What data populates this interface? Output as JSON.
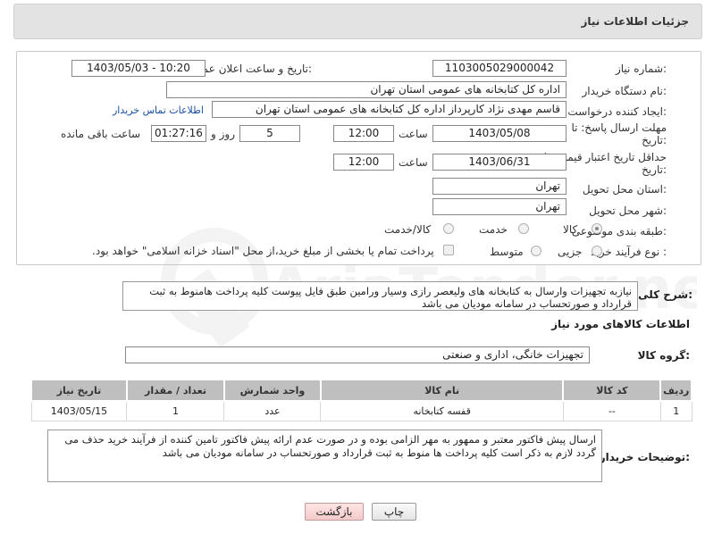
{
  "header": {
    "title": "جزئیات اطلاعات نیاز"
  },
  "fields": {
    "need_number_label": "شماره نیاز:",
    "need_number": "1103005029000042",
    "announce_label": "تاریخ و ساعت اعلان عمومی:",
    "announce_value": "1403/05/03 - 10:20",
    "buyer_org_label": "نام دستگاه خریدار:",
    "buyer_org": "اداره کل کتابخانه های عمومی استان تهران",
    "requester_label": "ایجاد کننده درخواست:",
    "requester": "قاسم مهدی نژاد کارپرداز اداره کل کتابخانه های عمومی استان تهران",
    "contact_link": "اطلاعات تماس خریدار",
    "reply_deadline_label_1": "مهلت ارسال پاسخ: تا",
    "reply_deadline_label_2": "تاریخ:",
    "reply_date": "1403/05/08",
    "time_label": "ساعت",
    "reply_time": "12:00",
    "days": "5",
    "days_label": "روز و",
    "remaining_time": "01:27:16",
    "remaining_label": "ساعت باقی مانده",
    "price_validity_label_1": "حداقل تاریخ اعتبار قیمت: تا",
    "price_validity_label_2": "تاریخ:",
    "validity_date": "1403/06/31",
    "validity_time": "12:00",
    "province_label": "استان محل تحویل:",
    "province": "تهران",
    "city_label": "شهر محل تحویل:",
    "city": "تهران",
    "category_label": "طبقه بندی موضوعی:",
    "category_options": [
      "کالا",
      "خدمت",
      "کالا/خدمت"
    ],
    "process_label": "نوع فرآیند خرید :",
    "process_options": [
      "جزیی",
      "متوسط"
    ],
    "payment_note": "پرداخت تمام یا بخشی از مبلغ خرید،از محل \"اسناد خزانه اسلامی\" خواهد بود."
  },
  "description": {
    "label": "شرح کلی نیاز:",
    "text": "نیازبه تجهیزات وارسال به کتابخانه های ولیعصر رازی وسیار ورامین طبق فایل پیوست کلیه پرداخت هامنوط به ثبت قرارداد و صورتحساب در سامانه مودیان می باشد"
  },
  "goods_info_title": "اطلاعات کالاهای مورد نیاز",
  "goods_group": {
    "label": "گروه کالا:",
    "value": "تجهیزات خانگی، اداری و صنعتی"
  },
  "table": {
    "headers": [
      "ردیف",
      "کد کالا",
      "نام کالا",
      "واحد شمارش",
      "تعداد / مقدار",
      "تاریخ نیاز"
    ],
    "rows": [
      [
        "1",
        "--",
        "قفسه کتابخانه",
        "عدد",
        "1",
        "1403/05/15"
      ]
    ]
  },
  "buyer_notes": {
    "label": "توضیحات خریدار:",
    "text": "ارسال پیش فاکتور معتبر و ممهور به مهر الزامی بوده و در صورت عدم ارائه پیش فاکتور تامین کننده از فرآیند خرید حذف می گردد لازم به ذکر است کلیه پرداخت ها منوط به ثبت قرارداد و صورتحساب در سامانه مودیان می باشد"
  },
  "buttons": {
    "print": "چاپ",
    "back": "بازگشت"
  },
  "watermark_text": "AriaTender.net"
}
